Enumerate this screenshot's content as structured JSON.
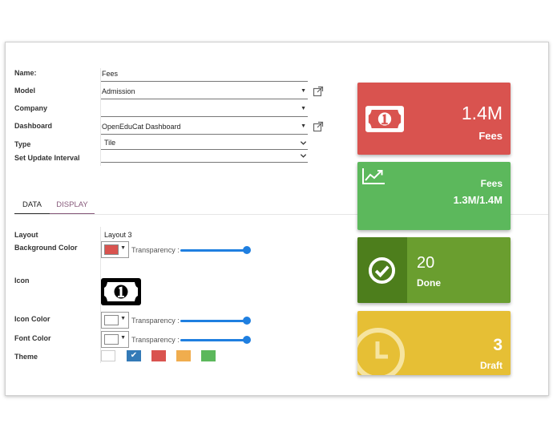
{
  "form": {
    "labels": {
      "name": "Name:",
      "model": "Model",
      "company": "Company",
      "dashboard": "Dashboard",
      "type": "Type",
      "interval": "Set Update Interval"
    },
    "values": {
      "name": "Fees",
      "model": "Admission",
      "company": "",
      "dashboard": "OpenEduCat Dashboard",
      "type": "Tile",
      "interval": ""
    }
  },
  "tabs": [
    {
      "label": "DATA",
      "active": true
    },
    {
      "label": "DISPLAY",
      "active": false
    }
  ],
  "display": {
    "layout_label": "Layout",
    "layout_value": "Layout 3",
    "bg_color_label": "Background Color",
    "icon_label": "Icon",
    "icon_color_label": "Icon Color",
    "font_color_label": "Font Color",
    "theme_label": "Theme",
    "transparency_label": "Transparency :",
    "bg_color": "#d9534f",
    "icon_color": "#ffffff",
    "font_color": "#ffffff",
    "bg_transparency": 1,
    "icon_transparency": 1,
    "font_transparency": 1,
    "themes": [
      {
        "color": "#ffffff",
        "selected": false
      },
      {
        "color": "#337ab7",
        "selected": true
      },
      {
        "color": "#d9534f",
        "selected": false
      },
      {
        "color": "#f0ad4e",
        "selected": false
      },
      {
        "color": "#5cb85c",
        "selected": false
      }
    ],
    "icon": "money-bill-icon"
  },
  "tiles": [
    {
      "value": "1.4M",
      "name": "Fees",
      "color": "#d9534f",
      "icon": "money-bill-icon"
    },
    {
      "name": "Fees",
      "value": "1.3M/1.4M",
      "color": "#5cb85c",
      "icon": "line-chart-icon"
    },
    {
      "value": "20",
      "name": "Done",
      "color": "#6a9e2f",
      "accent": "#4d7e1c",
      "icon": "check-circle-icon"
    },
    {
      "value": "3",
      "name": "Draft",
      "color": "#e6bf35",
      "icon": "clock-icon"
    }
  ]
}
